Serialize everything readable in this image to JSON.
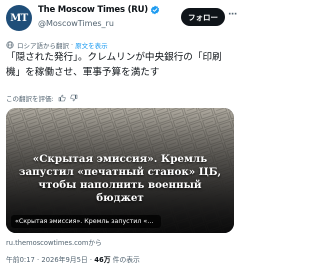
{
  "header": {
    "avatar_text": "MT",
    "name": "The Moscow Times (RU)",
    "handle": "@MoscowTimes_ru",
    "follow_label": "フォロー",
    "more_label": "···",
    "icons": [
      "verified-badge-icon",
      "more-icon"
    ],
    "colors": {
      "avatar": "#1f4e79",
      "verified": "#1d9bf0",
      "follow_bg": "#0f1419"
    }
  },
  "translation": {
    "translated_from": "ロシア語から翻訳",
    "separator": "·",
    "show_original": "原文を表示",
    "rate_prompt": "この翻訳を評価:",
    "icons": [
      "globe-icon",
      "thumbs-up-icon",
      "thumbs-down-icon"
    ]
  },
  "post": {
    "text": "「隠された発行」。クレムリンが中央銀行の「印刷機」を稼働させ、軍事予算を満たす"
  },
  "card": {
    "headline": "«Скрытая эмиссия». Кремль запустил «печатный станок» ЦБ, чтобы наполнить военный бюджет",
    "caption": "«Скрытая эмиссия». Кремль запустил «печатный стан...",
    "domain": "ru.themoscowtimes.comから"
  },
  "meta": {
    "time": "午前0:17",
    "separator": "·",
    "date": "2026年9月5日",
    "views_count": "46万",
    "views_label": "件の表示"
  }
}
